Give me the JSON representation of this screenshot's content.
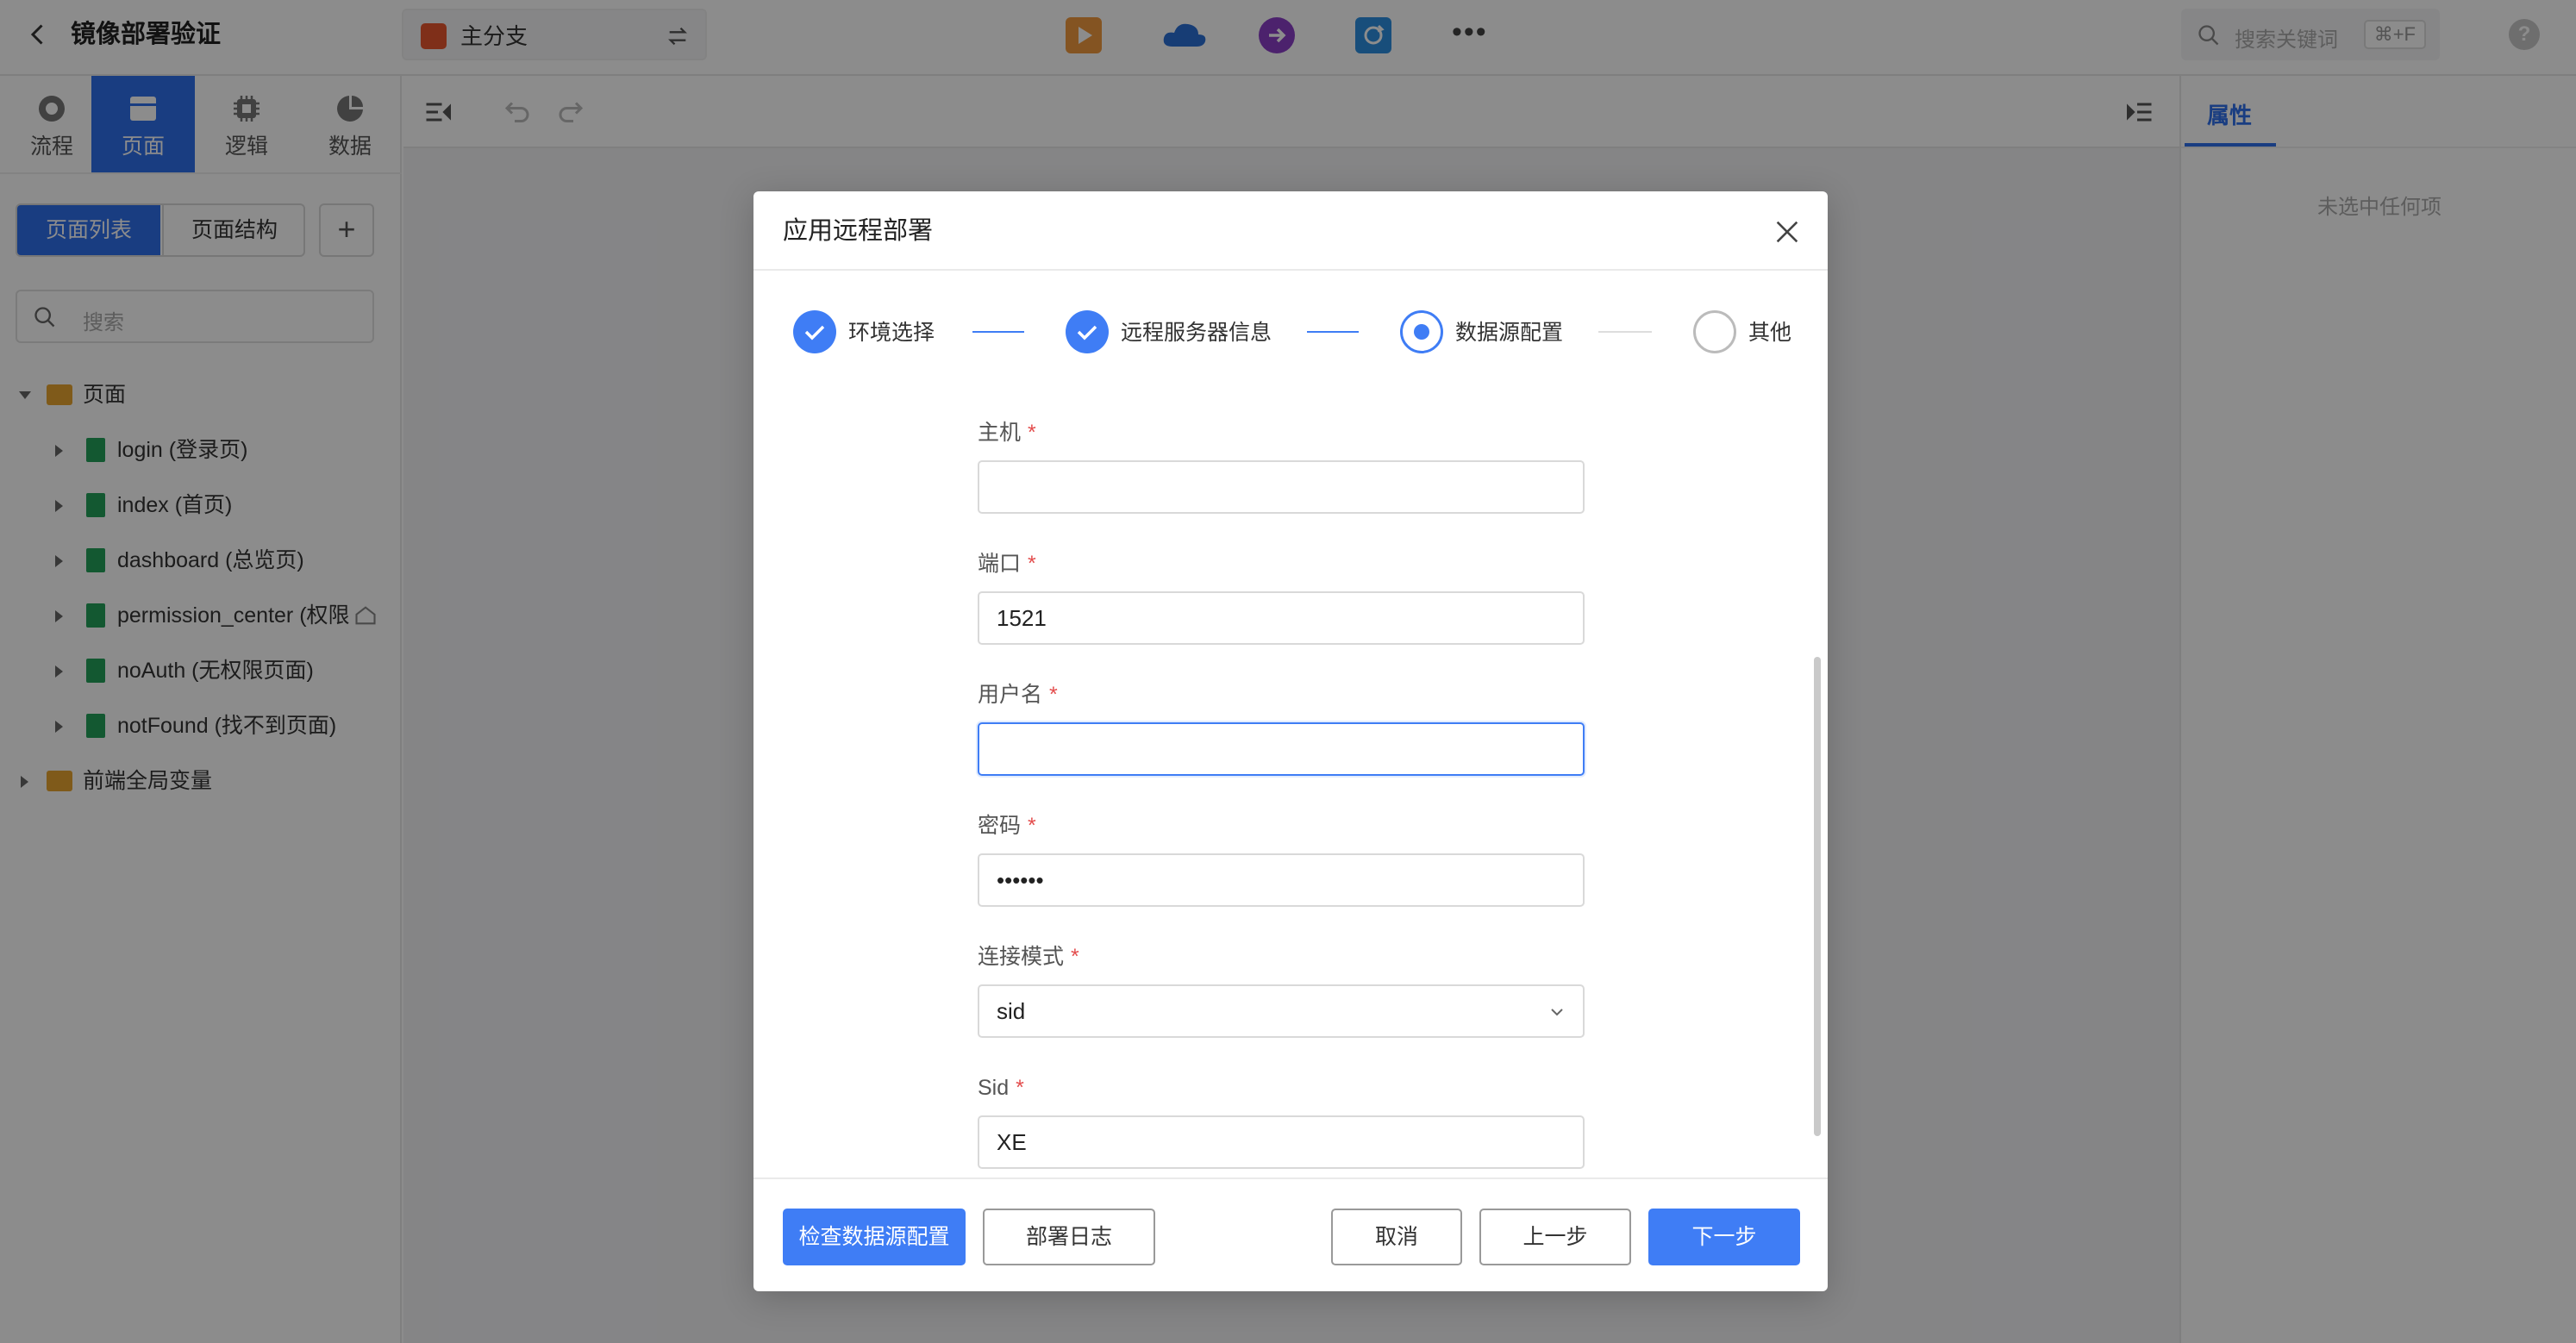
{
  "topbar": {
    "title": "镜像部署验证",
    "branch": "主分支",
    "search_placeholder": "搜索关键词",
    "search_shortcut": "⌘+F",
    "help": "?"
  },
  "sidebar": {
    "modes": [
      {
        "label": "流程",
        "icon": "flow-icon"
      },
      {
        "label": "页面",
        "icon": "page-icon"
      },
      {
        "label": "逻辑",
        "icon": "logic-icon"
      },
      {
        "label": "数据",
        "icon": "data-icon"
      }
    ],
    "active_mode": "页面",
    "segments": [
      "页面列表",
      "页面结构"
    ],
    "add": "+",
    "search_placeholder": "搜索",
    "tree": {
      "root_label": "页面",
      "pages": [
        "login (登录页)",
        "index (首页)",
        "dashboard (总览页)",
        "permission_center (权限中心)",
        "noAuth (无权限页面)",
        "notFound (找不到页面)"
      ],
      "globals_label": "前端全局变量"
    }
  },
  "right_panel": {
    "tab": "属性",
    "empty": "未选中任何项"
  },
  "modal": {
    "title": "应用远程部署",
    "steps": [
      {
        "label": "环境选择",
        "status": "done"
      },
      {
        "label": "远程服务器信息",
        "status": "done"
      },
      {
        "label": "数据源配置",
        "status": "active"
      },
      {
        "label": "其他",
        "status": "todo"
      }
    ],
    "fields": {
      "host": {
        "label": "主机",
        "value": ""
      },
      "port": {
        "label": "端口",
        "value": "1521"
      },
      "username": {
        "label": "用户名",
        "value": ""
      },
      "password": {
        "label": "密码",
        "value": "••••••"
      },
      "mode": {
        "label": "连接模式",
        "value": "sid"
      },
      "sid": {
        "label": "Sid",
        "value": "XE"
      }
    },
    "required_mark": "*",
    "buttons": {
      "check": "检查数据源配置",
      "log": "部署日志",
      "cancel": "取消",
      "prev": "上一步",
      "next": "下一步"
    }
  },
  "colors": {
    "primary": "#3f7df5",
    "sidebar_active": "#2f6fec",
    "required": "#e34d4d"
  }
}
